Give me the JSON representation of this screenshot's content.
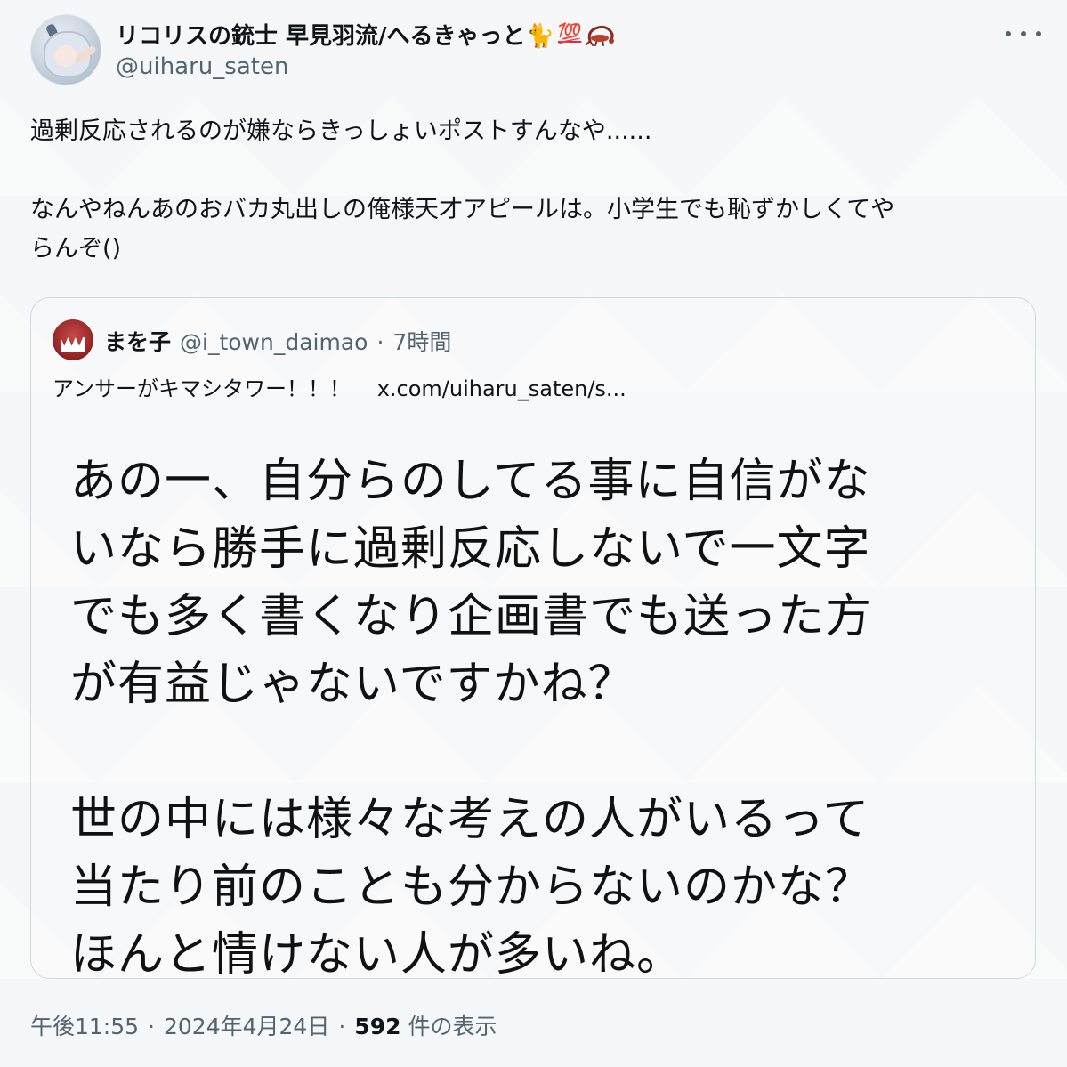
{
  "author": {
    "display_name": "リコリスの銃士 早見羽流/へるきゃっと🐈",
    "badge_text": "💯",
    "handle": "@uiharu_saten"
  },
  "tweet": {
    "line1": "過剰反応されるのが嫌ならきっしょいポストすんなや......",
    "line2": "なんやねんあのおバカ丸出しの俺様天才アピールは。小学生でも恥ずかしくてや",
    "line3": "らんぞ()"
  },
  "quote": {
    "name": "まを子",
    "handle": "@i_town_daimao",
    "separator": "·",
    "time": "7時間",
    "text": "アンサーがキマシタワー！！！",
    "link": "x.com/uiharu_saten/s...",
    "image_lines": [
      "あの一、自分らのしてる事に自信がな",
      "いなら勝手に過剰反応しないで一文字",
      "でも多く書くなり企画書でも送った方",
      "が有益じゃないですかね？",
      "世の中には様々な考えの人がいるって",
      "当たり前のことも分からないのかな？",
      "ほんと情けない人が多いね。"
    ]
  },
  "footer": {
    "time": "午後11:55",
    "sep1": "·",
    "date": "2024年4月24日",
    "sep2": "·",
    "views_count": "592",
    "views_label": "件の表示"
  },
  "icons": {
    "more": "more-dots-icon",
    "scorpion": "scorpion-icon"
  },
  "colors": {
    "text": "#0f1419",
    "secondary": "#536471",
    "border": "#cfd9de",
    "badge": "#e0245e"
  }
}
